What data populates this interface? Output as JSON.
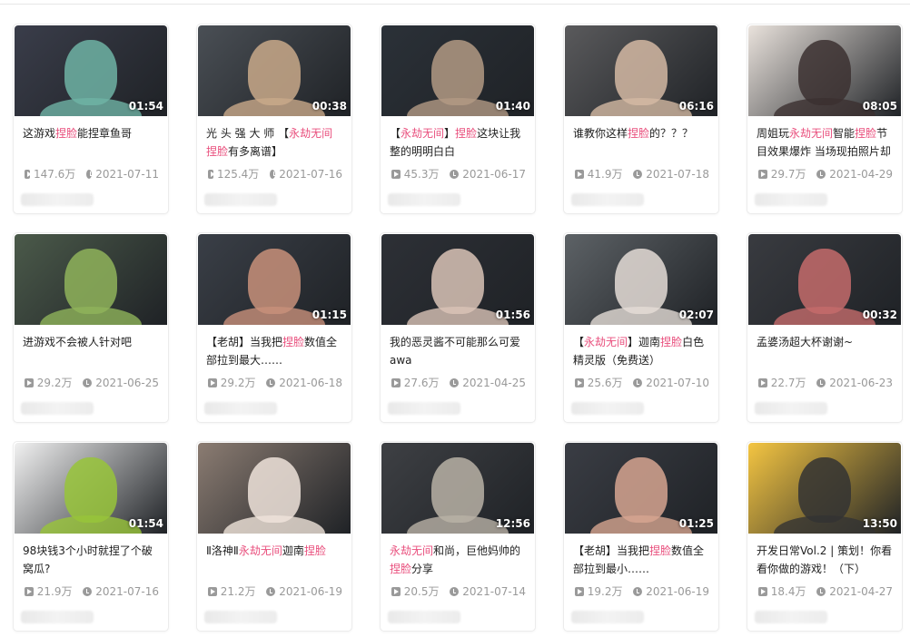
{
  "videos": [
    {
      "title_parts": [
        {
          "t": "这游戏",
          "h": false
        },
        {
          "t": "捏脸",
          "h": true
        },
        {
          "t": "能捏章鱼哥",
          "h": false
        }
      ],
      "duration": "01:54",
      "views": "147.6万",
      "date": "2021-07-11",
      "thumb_bg": "#3a3d4a",
      "thumb_fg": "#6fb3a5"
    },
    {
      "title_parts": [
        {
          "t": "光 头 强 大 师 【",
          "h": false
        },
        {
          "t": "永劫无间",
          "h": true
        },
        {
          "t": " ",
          "h": false
        },
        {
          "t": "捏脸",
          "h": true
        },
        {
          "t": "有多离谱】",
          "h": false
        }
      ],
      "duration": "00:38",
      "views": "125.4万",
      "date": "2021-07-16",
      "thumb_bg": "#4a4f55",
      "thumb_fg": "#c9a98a"
    },
    {
      "title_parts": [
        {
          "t": "【",
          "h": false
        },
        {
          "t": "永劫无间",
          "h": true
        },
        {
          "t": "】",
          "h": false
        },
        {
          "t": "捏脸",
          "h": true
        },
        {
          "t": "这块让我整的明明白白",
          "h": false
        }
      ],
      "duration": "01:40",
      "views": "45.3万",
      "date": "2021-06-17",
      "thumb_bg": "#2b3138",
      "thumb_fg": "#b39a84"
    },
    {
      "title_parts": [
        {
          "t": "谁教你这样",
          "h": false
        },
        {
          "t": "捏脸",
          "h": true
        },
        {
          "t": "的？？？",
          "h": false
        }
      ],
      "duration": "06:16",
      "views": "41.9万",
      "date": "2021-07-18",
      "thumb_bg": "#5a5a5c",
      "thumb_fg": "#d3b9a3"
    },
    {
      "title_parts": [
        {
          "t": "周姐玩",
          "h": false
        },
        {
          "t": "永劫无间",
          "h": true
        },
        {
          "t": "智能",
          "h": false
        },
        {
          "t": "捏脸",
          "h": true
        },
        {
          "t": "节目效果爆炸 当场现拍照片却",
          "h": false
        }
      ],
      "duration": "08:05",
      "views": "29.7万",
      "date": "2021-04-29",
      "thumb_bg": "#e9e2dc",
      "thumb_fg": "#3b3030"
    },
    {
      "title_parts": [
        {
          "t": "进游戏不会被人针对吧",
          "h": false
        }
      ],
      "duration": "",
      "views": "29.2万",
      "date": "2021-06-25",
      "thumb_bg": "#4b5a4a",
      "thumb_fg": "#8fb35a"
    },
    {
      "title_parts": [
        {
          "t": "【老胡】当我把",
          "h": false
        },
        {
          "t": "捏脸",
          "h": true
        },
        {
          "t": "数值全部拉到最大……",
          "h": false
        }
      ],
      "duration": "01:15",
      "views": "29.2万",
      "date": "2021-06-18",
      "thumb_bg": "#3a3f47",
      "thumb_fg": "#c8907a"
    },
    {
      "title_parts": [
        {
          "t": "我的恶灵酱不可能那么可爱awa",
          "h": false
        }
      ],
      "duration": "01:56",
      "views": "27.6万",
      "date": "2021-04-25",
      "thumb_bg": "#2d3036",
      "thumb_fg": "#d9c3b6"
    },
    {
      "title_parts": [
        {
          "t": "【",
          "h": false
        },
        {
          "t": "永劫无间",
          "h": true
        },
        {
          "t": "】迦南",
          "h": false
        },
        {
          "t": "捏脸",
          "h": true
        },
        {
          "t": "白色精灵版（免费送）",
          "h": false
        }
      ],
      "duration": "02:07",
      "views": "25.6万",
      "date": "2021-07-10",
      "thumb_bg": "#5d6266",
      "thumb_fg": "#e4dcd6"
    },
    {
      "title_parts": [
        {
          "t": "孟婆汤超大杯谢谢~",
          "h": false
        }
      ],
      "duration": "00:32",
      "views": "22.7万",
      "date": "2021-06-23",
      "thumb_bg": "#393b40",
      "thumb_fg": "#c46b6b"
    },
    {
      "title_parts": [
        {
          "t": "98块钱3个小时就捏了个破窝瓜?",
          "h": false
        }
      ],
      "duration": "01:54",
      "views": "21.9万",
      "date": "2021-07-16",
      "thumb_bg": "#f1f1f1",
      "thumb_fg": "#98c43a"
    },
    {
      "title_parts": [
        {
          "t": "Ⅱ洛神Ⅱ",
          "h": false
        },
        {
          "t": "永劫无间",
          "h": true
        },
        {
          "t": "迦南",
          "h": false
        },
        {
          "t": "捏脸",
          "h": true
        }
      ],
      "duration": "",
      "views": "21.2万",
      "date": "2021-06-19",
      "thumb_bg": "#8b7c72",
      "thumb_fg": "#efe3da"
    },
    {
      "title_parts": [
        {
          "t": "永劫无间",
          "h": true
        },
        {
          "t": "和尚，巨他妈帅的",
          "h": false
        },
        {
          "t": "捏脸",
          "h": true
        },
        {
          "t": "分享",
          "h": false
        }
      ],
      "duration": "12:56",
      "views": "20.5万",
      "date": "2021-07-14",
      "thumb_bg": "#3e4044",
      "thumb_fg": "#b9b2a6"
    },
    {
      "title_parts": [
        {
          "t": "【老胡】当我把",
          "h": false
        },
        {
          "t": "捏脸",
          "h": true
        },
        {
          "t": "数值全部拉到最小……",
          "h": false
        }
      ],
      "duration": "01:25",
      "views": "19.2万",
      "date": "2021-06-19",
      "thumb_bg": "#3a3d44",
      "thumb_fg": "#d6a590"
    },
    {
      "title_parts": [
        {
          "t": "开发日常Vol.2 | 策划！你看看你做的游戏！（下）",
          "h": false
        }
      ],
      "duration": "13:50",
      "views": "18.4万",
      "date": "2021-04-27",
      "thumb_bg": "#f4c542",
      "thumb_fg": "#333333"
    }
  ]
}
